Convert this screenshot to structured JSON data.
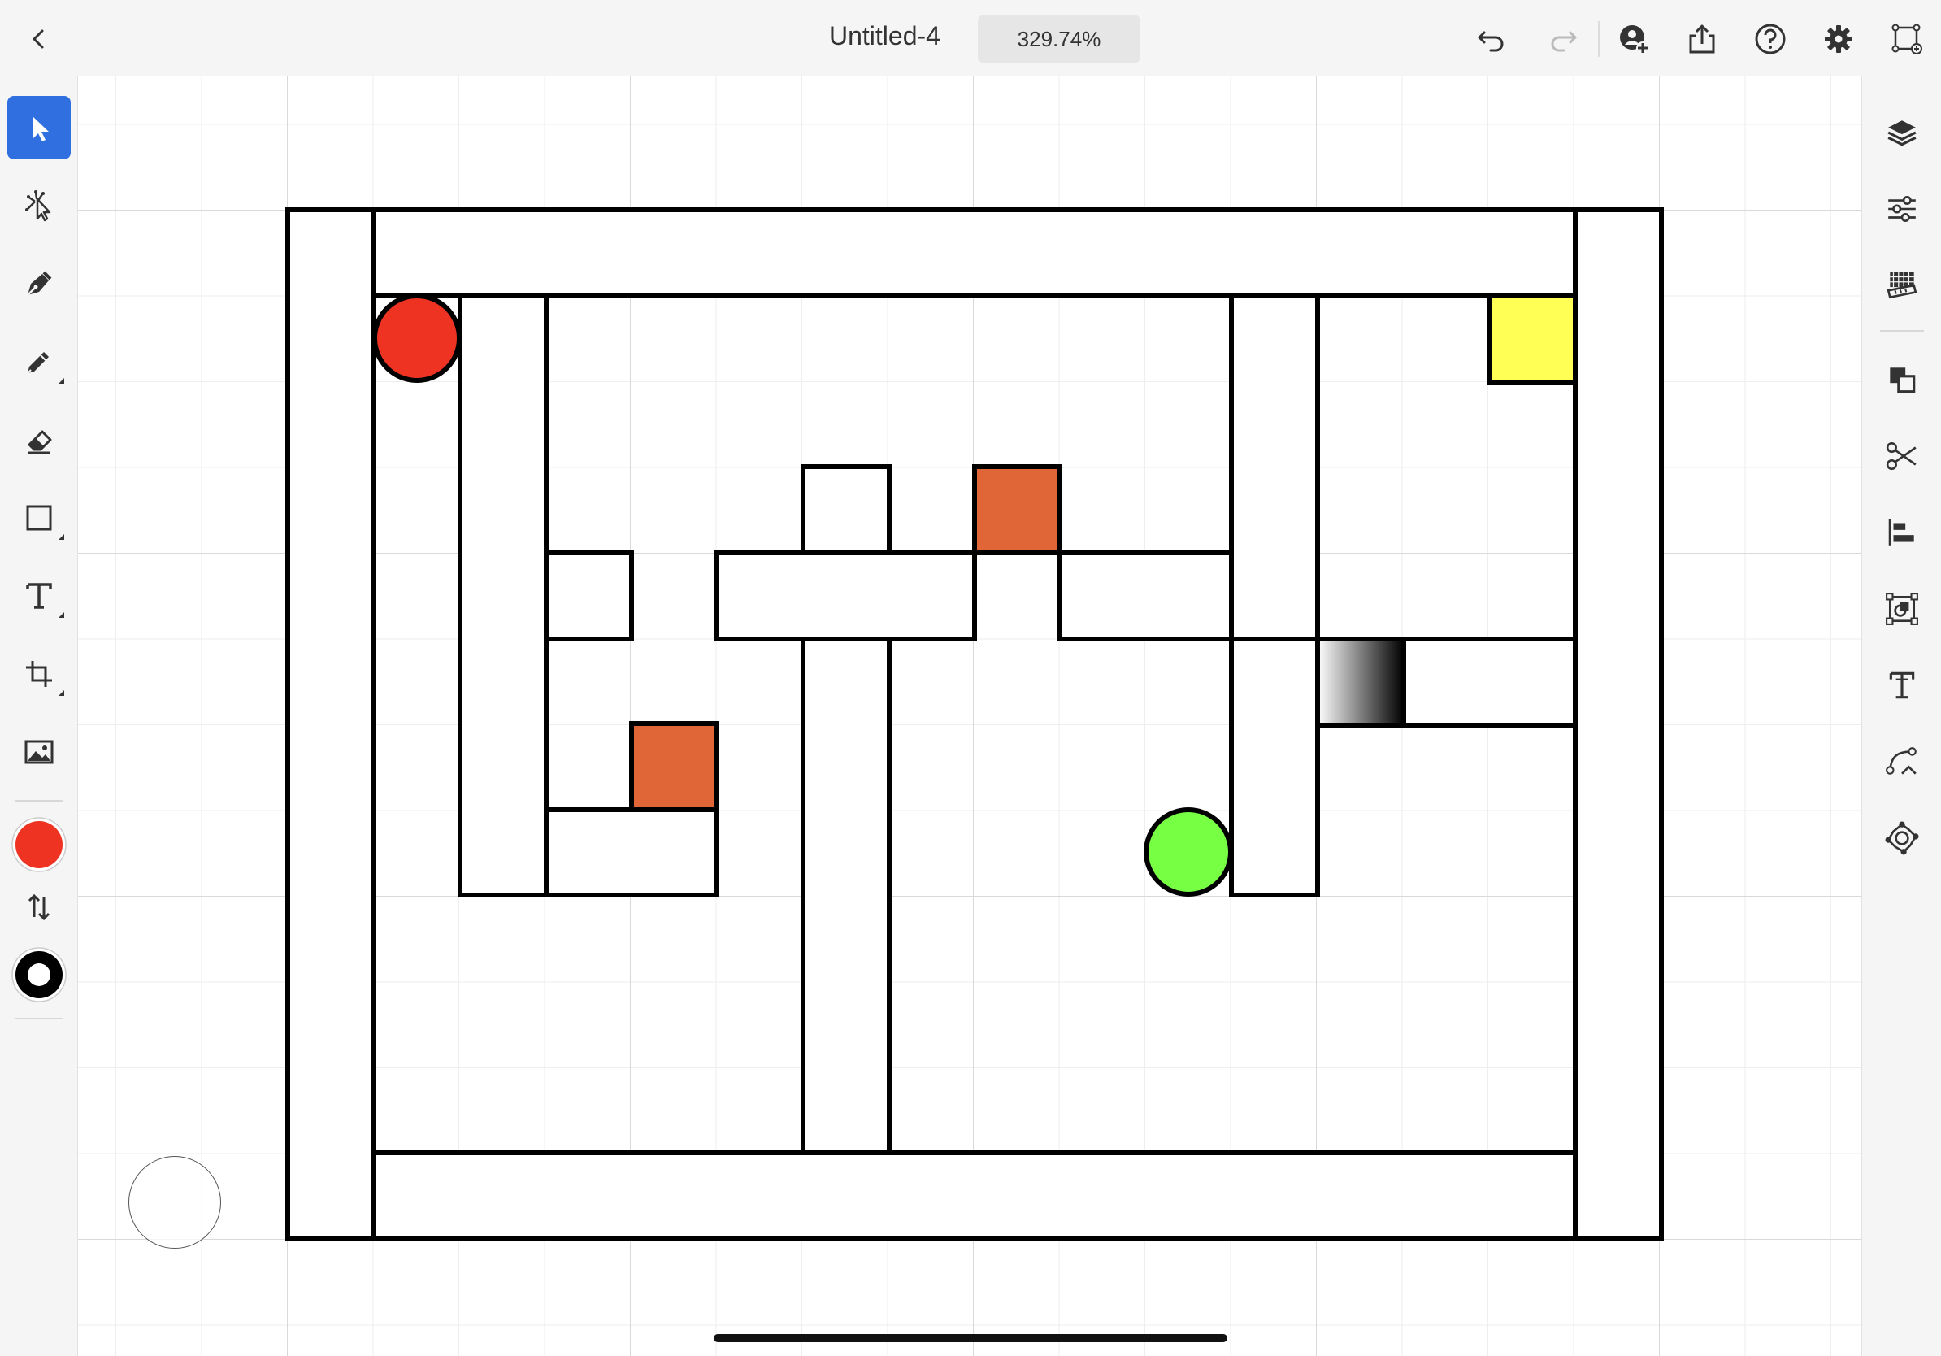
{
  "header": {
    "title": "Untitled-4",
    "zoom": "329.74%"
  },
  "colors": {
    "fill": "#ee3322",
    "stroke": "#000000",
    "active_tool": "#2f6fe0",
    "red_ball": "#ee3322",
    "green_ball": "#77ff44",
    "yellow_block": "#ffff55",
    "orange_block": "#e06637"
  },
  "toolbar_icons": [
    "back-icon",
    "undo-icon",
    "redo-icon",
    "invite-icon",
    "share-icon",
    "help-icon",
    "settings-icon",
    "edit-artboards-icon"
  ],
  "left_tools": [
    "selection-tool",
    "direct-selection-tool",
    "pen-tool",
    "pencil-tool",
    "eraser-tool",
    "shape-tool",
    "type-tool",
    "artboard-tool",
    "image-tool",
    "fill-color-swatch",
    "swap-colors-icon",
    "stroke-color-swatch"
  ],
  "right_panels": [
    "layers-icon",
    "properties-icon",
    "libraries-icon",
    "arrange-icon",
    "scissors-icon",
    "align-icon",
    "transform-icon",
    "type-panel-icon",
    "path-icon",
    "pathfinder-icon"
  ]
}
